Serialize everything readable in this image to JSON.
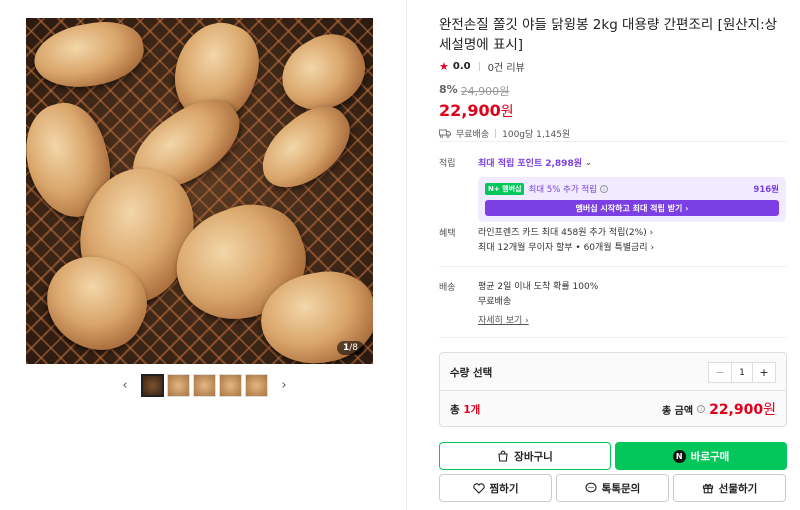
{
  "gallery": {
    "counter_current": "1",
    "counter_total": "/8",
    "prev_arrow": "‹",
    "next_arrow": "›",
    "thumb_count": 5
  },
  "product": {
    "title": "완전손질 쫄깃 야들 닭윙봉 2kg 대용량 간편조리 [원산지:상세설명에 표시]",
    "rating": "0.0",
    "review_count": "0건 리뷰",
    "discount": "8%",
    "original_price": "24,900원",
    "sale_price": "22,900",
    "sale_unit": "원",
    "shipping": "무료배송",
    "unit_price": "100g당 1,145원"
  },
  "points": {
    "label": "적립",
    "max_point_text": "최대 적립 포인트 ",
    "max_point_value": "2,898원",
    "np_badge": "N+ 멤버십",
    "member_extra": "최대 5% 추가 적립",
    "member_amount": "916원",
    "member_button": "멤버십 시작하고 최대 적립 받기 ›"
  },
  "benefits": {
    "label": "혜택",
    "line1": "라인프렌즈 카드 최대 458원 추가 적립(2%) ›",
    "line2": "최대 12개월 무이자 할부 • 60개월 특별금리 ›"
  },
  "delivery": {
    "label": "배송",
    "line1": "평균 2일 이내 도착 확률 100%",
    "line2": "무료배송",
    "detail_link": "자세히 보기 ›"
  },
  "quantity": {
    "heading": "수량 선택",
    "value": "1",
    "minus": "−",
    "plus": "+",
    "total_count_prefix": "총 ",
    "total_count_num": "1개",
    "total_label": "총 금액",
    "total_price": "22,900",
    "total_unit": "원"
  },
  "buttons": {
    "cart": "장바구니",
    "buy": "바로구매",
    "wish": "찜하기",
    "talk": "톡톡문의",
    "gift": "선물하기"
  },
  "colors": {
    "accent_red": "#e0001c",
    "naver_green": "#03c75a",
    "member_purple": "#7b3fe4"
  }
}
